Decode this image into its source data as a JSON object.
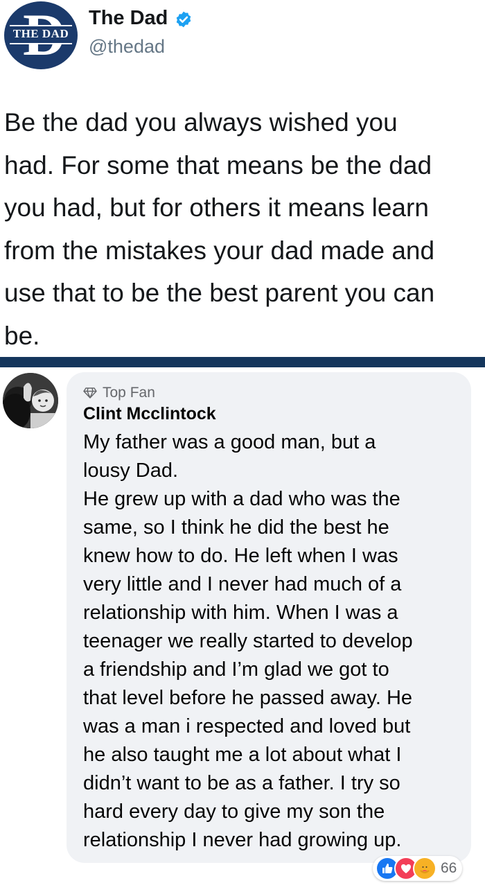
{
  "tweet": {
    "avatar_logo_text": "THE DAD",
    "display_name": "The Dad",
    "handle": "@thedad",
    "text": "Be the dad you always wished you\nhad. For some that means be the dad\nyou had, but for others it means learn\nfrom the mistakes your dad made and\nuse that to be the best parent you can\nbe."
  },
  "comment": {
    "badge": "Top Fan",
    "author": "Clint Mcclintock",
    "text": "My father was a good man, but a\nlousy Dad.\nHe grew up with a dad who was the\nsame, so I think he did the best he\nknew how to do. He left when I was\nvery little and I never had much of a\nrelationship with him. When I was a\nteenager we really started to develop\na friendship and I’m glad we got to\nthat level before he passed away. He\nwas a man i respected and loved but\nhe also taught me a lot about what I\ndidn’t want to be as a father. I try so\nhard every day to give my son the\nrelationship I never had growing up.",
    "reactions": {
      "icons": [
        "like-icon",
        "love-icon",
        "care-icon"
      ],
      "count": "66"
    }
  },
  "colors": {
    "twitter_blue": "#1da1f2",
    "divider_navy": "#14365c",
    "logo_navy": "#1b3a6b",
    "bubble_gray": "#f0f2f5",
    "like_blue": "#1877f2",
    "love_red": "#f33e58",
    "care_yellow": "#f7b125"
  }
}
